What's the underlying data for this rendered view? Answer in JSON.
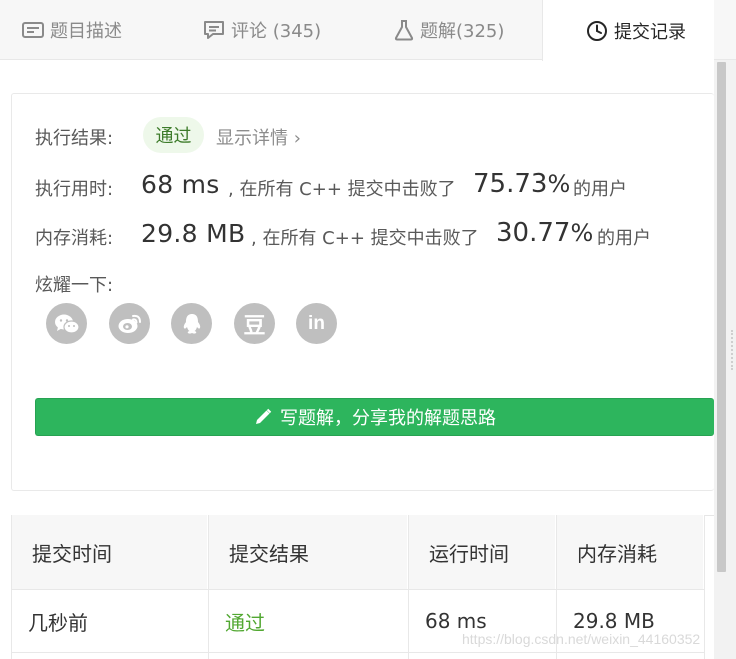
{
  "tabs": [
    {
      "label": "题目描述",
      "icon": "description-icon"
    },
    {
      "label": "评论 (345)",
      "icon": "comment-icon"
    },
    {
      "label": "题解(325)",
      "icon": "flask-icon"
    },
    {
      "label": "提交记录",
      "icon": "clock-icon"
    }
  ],
  "result": {
    "label": "执行结果:",
    "status": "通过",
    "details_link": "显示详情 ›"
  },
  "runtime": {
    "label": "执行用时:",
    "value": "68 ms",
    "text_before": ", 在所有 C++ 提交中击败了",
    "percent": "75.73",
    "percent_sign": "%",
    "text_after": "的用户"
  },
  "memory": {
    "label": "内存消耗:",
    "value": "29.8 MB",
    "text_before": ", 在所有 C++ 提交中击败了",
    "percent": "30.77",
    "percent_sign": "%",
    "text_after": "的用户"
  },
  "share": {
    "label": "炫耀一下:",
    "icons": [
      "wechat-icon",
      "weibo-icon",
      "qq-icon",
      "douban-icon",
      "linkedin-icon"
    ],
    "douban_glyph": "豆",
    "linkedin_glyph": "in"
  },
  "write_button": {
    "label": "写题解，分享我的解题思路",
    "icon": "pencil-icon"
  },
  "table": {
    "headers": [
      "提交时间",
      "提交结果",
      "运行时间",
      "内存消耗"
    ],
    "rows": [
      [
        "几秒前",
        "通过",
        "68 ms",
        "29.8 MB"
      ]
    ]
  },
  "watermark": "https://blog.csdn.net/weixin_44160352",
  "colors": {
    "accent_green": "#2db55d",
    "pass_text": "#52a832",
    "badge_bg": "#eef8ea"
  }
}
